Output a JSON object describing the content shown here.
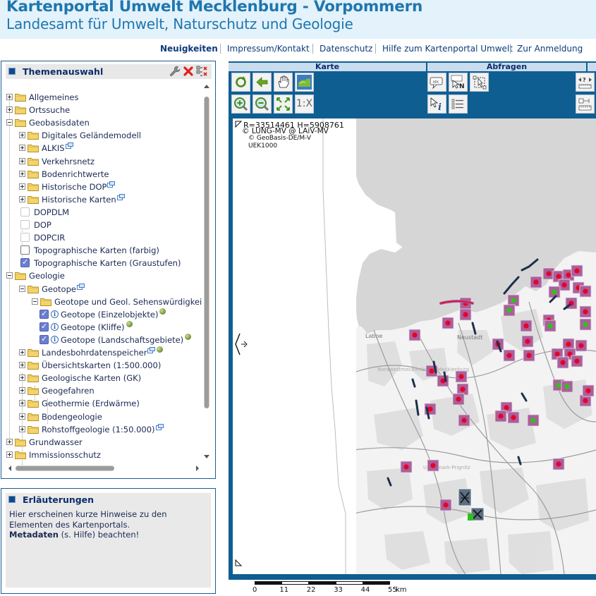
{
  "header": {
    "title": "Kartenportal Umwelt Mecklenburg - Vorpommern",
    "subtitle": "Landesamt für Umwelt, Naturschutz und Geologie"
  },
  "nav": [
    "Neuigkeiten",
    "Impressum/Kontakt",
    "Datenschutz",
    "Hilfe zum Kartenportal Umwelt",
    "Zur Anmeldung"
  ],
  "themen": {
    "title": "Themenauswahl",
    "icons": [
      "wrench-icon",
      "close-icon",
      "collapse-tree-icon"
    ],
    "items": [
      {
        "label": "Allgemeines",
        "level": 0,
        "type": "folder",
        "expanded": false
      },
      {
        "label": "Ortssuche",
        "level": 0,
        "type": "folder",
        "expanded": false
      },
      {
        "label": "Geobasisdaten",
        "level": 0,
        "type": "folder",
        "expanded": true
      },
      {
        "label": "Digitales Geländemodell",
        "level": 1,
        "type": "folder",
        "expanded": false
      },
      {
        "label": "ALKIS",
        "level": 1,
        "type": "folder",
        "expanded": false,
        "ext": true
      },
      {
        "label": "Verkehrsnetz",
        "level": 1,
        "type": "folder",
        "expanded": false
      },
      {
        "label": "Bodenrichtwerte",
        "level": 1,
        "type": "folder",
        "expanded": false
      },
      {
        "label": "Historische DOP",
        "level": 1,
        "type": "folder",
        "expanded": false,
        "ext": true
      },
      {
        "label": "Historische Karten",
        "level": 1,
        "type": "folder",
        "expanded": false,
        "ext": true
      },
      {
        "label": "DOPDLM",
        "level": 1,
        "type": "check",
        "state": "disabled"
      },
      {
        "label": "DOP",
        "level": 1,
        "type": "check",
        "state": "disabled"
      },
      {
        "label": "DOPCIR",
        "level": 1,
        "type": "check",
        "state": "disabled"
      },
      {
        "label": "Topographische Karten (farbig)",
        "level": 1,
        "type": "check",
        "state": "unchecked"
      },
      {
        "label": "Topographische Karten (Graustufen)",
        "level": 1,
        "type": "check",
        "state": "checked"
      },
      {
        "label": "Geologie",
        "level": 0,
        "type": "folder",
        "expanded": true
      },
      {
        "label": "Geotope",
        "level": 1,
        "type": "folder",
        "expanded": true,
        "ext": true
      },
      {
        "label": "Geotope und Geol. Sehenswürdigkeiten",
        "level": 2,
        "type": "folder",
        "expanded": true
      },
      {
        "label": "Geotope (Einzelobjekte)",
        "level": 3,
        "type": "layer",
        "state": "checked",
        "globe": true
      },
      {
        "label": "Geotope (Kliffe)",
        "level": 3,
        "type": "layer",
        "state": "checked",
        "globe": true
      },
      {
        "label": "Geotope (Landschaftsgebiete)",
        "level": 3,
        "type": "layer",
        "state": "checked",
        "globe": true
      },
      {
        "label": "Landesbohrdatenspeicher",
        "level": 1,
        "type": "folder",
        "expanded": false,
        "ext": true,
        "globe": true
      },
      {
        "label": "Übersichtskarten (1:500.000)",
        "level": 1,
        "type": "folder",
        "expanded": false
      },
      {
        "label": "Geologische Karten (GK)",
        "level": 1,
        "type": "folder",
        "expanded": false
      },
      {
        "label": "Geogefahren",
        "level": 1,
        "type": "folder",
        "expanded": false
      },
      {
        "label": "Geothermie (Erdwärme)",
        "level": 1,
        "type": "folder",
        "expanded": false
      },
      {
        "label": "Bodengeologie",
        "level": 1,
        "type": "folder",
        "expanded": false
      },
      {
        "label": "Rohstoffgeologie (1:50.000)",
        "level": 1,
        "type": "folder",
        "expanded": false,
        "ext": true
      },
      {
        "label": "Grundwasser",
        "level": 0,
        "type": "folder",
        "expanded": false
      },
      {
        "label": "Immissionsschutz",
        "level": 0,
        "type": "folder",
        "expanded": false
      }
    ]
  },
  "erlaeuterungen": {
    "title": "Erläuterungen",
    "line1": "Hier erscheinen kurze Hinweise zu den Elementen des Kartenportals.",
    "metadaten_bold": "Metadaten",
    "metadaten_rest": " (s. Hilfe) beachten!"
  },
  "toolbar": {
    "sections": [
      "Karte",
      "Abfragen"
    ],
    "zoom_scale_label": "1:X",
    "tools": [
      "refresh-icon",
      "back-arrow-icon",
      "pan-hand-icon",
      "overview-map-icon",
      "zoom-in-icon",
      "zoom-out-icon",
      "zoom-extent-icon",
      "scale-button",
      "text-query-icon",
      "query-n-icon",
      "select-rectangle-icon",
      "info-query-icon",
      "list-query-icon",
      "measure-icon",
      "ruler-icon"
    ]
  },
  "map": {
    "coords": "R=33514461 H=5908761",
    "copyright1": "© LUNG-MV @ LAiV-MV",
    "copyright2": "© GeoBasis-DE/M-V",
    "copyright3": "UEK1000",
    "place_labels": [
      "Laboe",
      "Neustadt",
      "Nordwestmecklenburg",
      "Mecklenburg",
      "Uckermark-Prignitz"
    ]
  },
  "scalebar": {
    "labels": [
      "0",
      "11",
      "22",
      "33",
      "44",
      "55"
    ],
    "unit": "km"
  },
  "colors": {
    "header_bg": "#e3f2fb",
    "brand_blue": "#1f76ae",
    "panel_border": "#1a5e96",
    "map_frame": "#0f5e92",
    "sea": "#d4d4d4",
    "geotope_fill": "#a9609a",
    "geotope_point": "#e8002a",
    "kliff_dark": "#1e2f4a",
    "green_point": "#2ec21c"
  }
}
